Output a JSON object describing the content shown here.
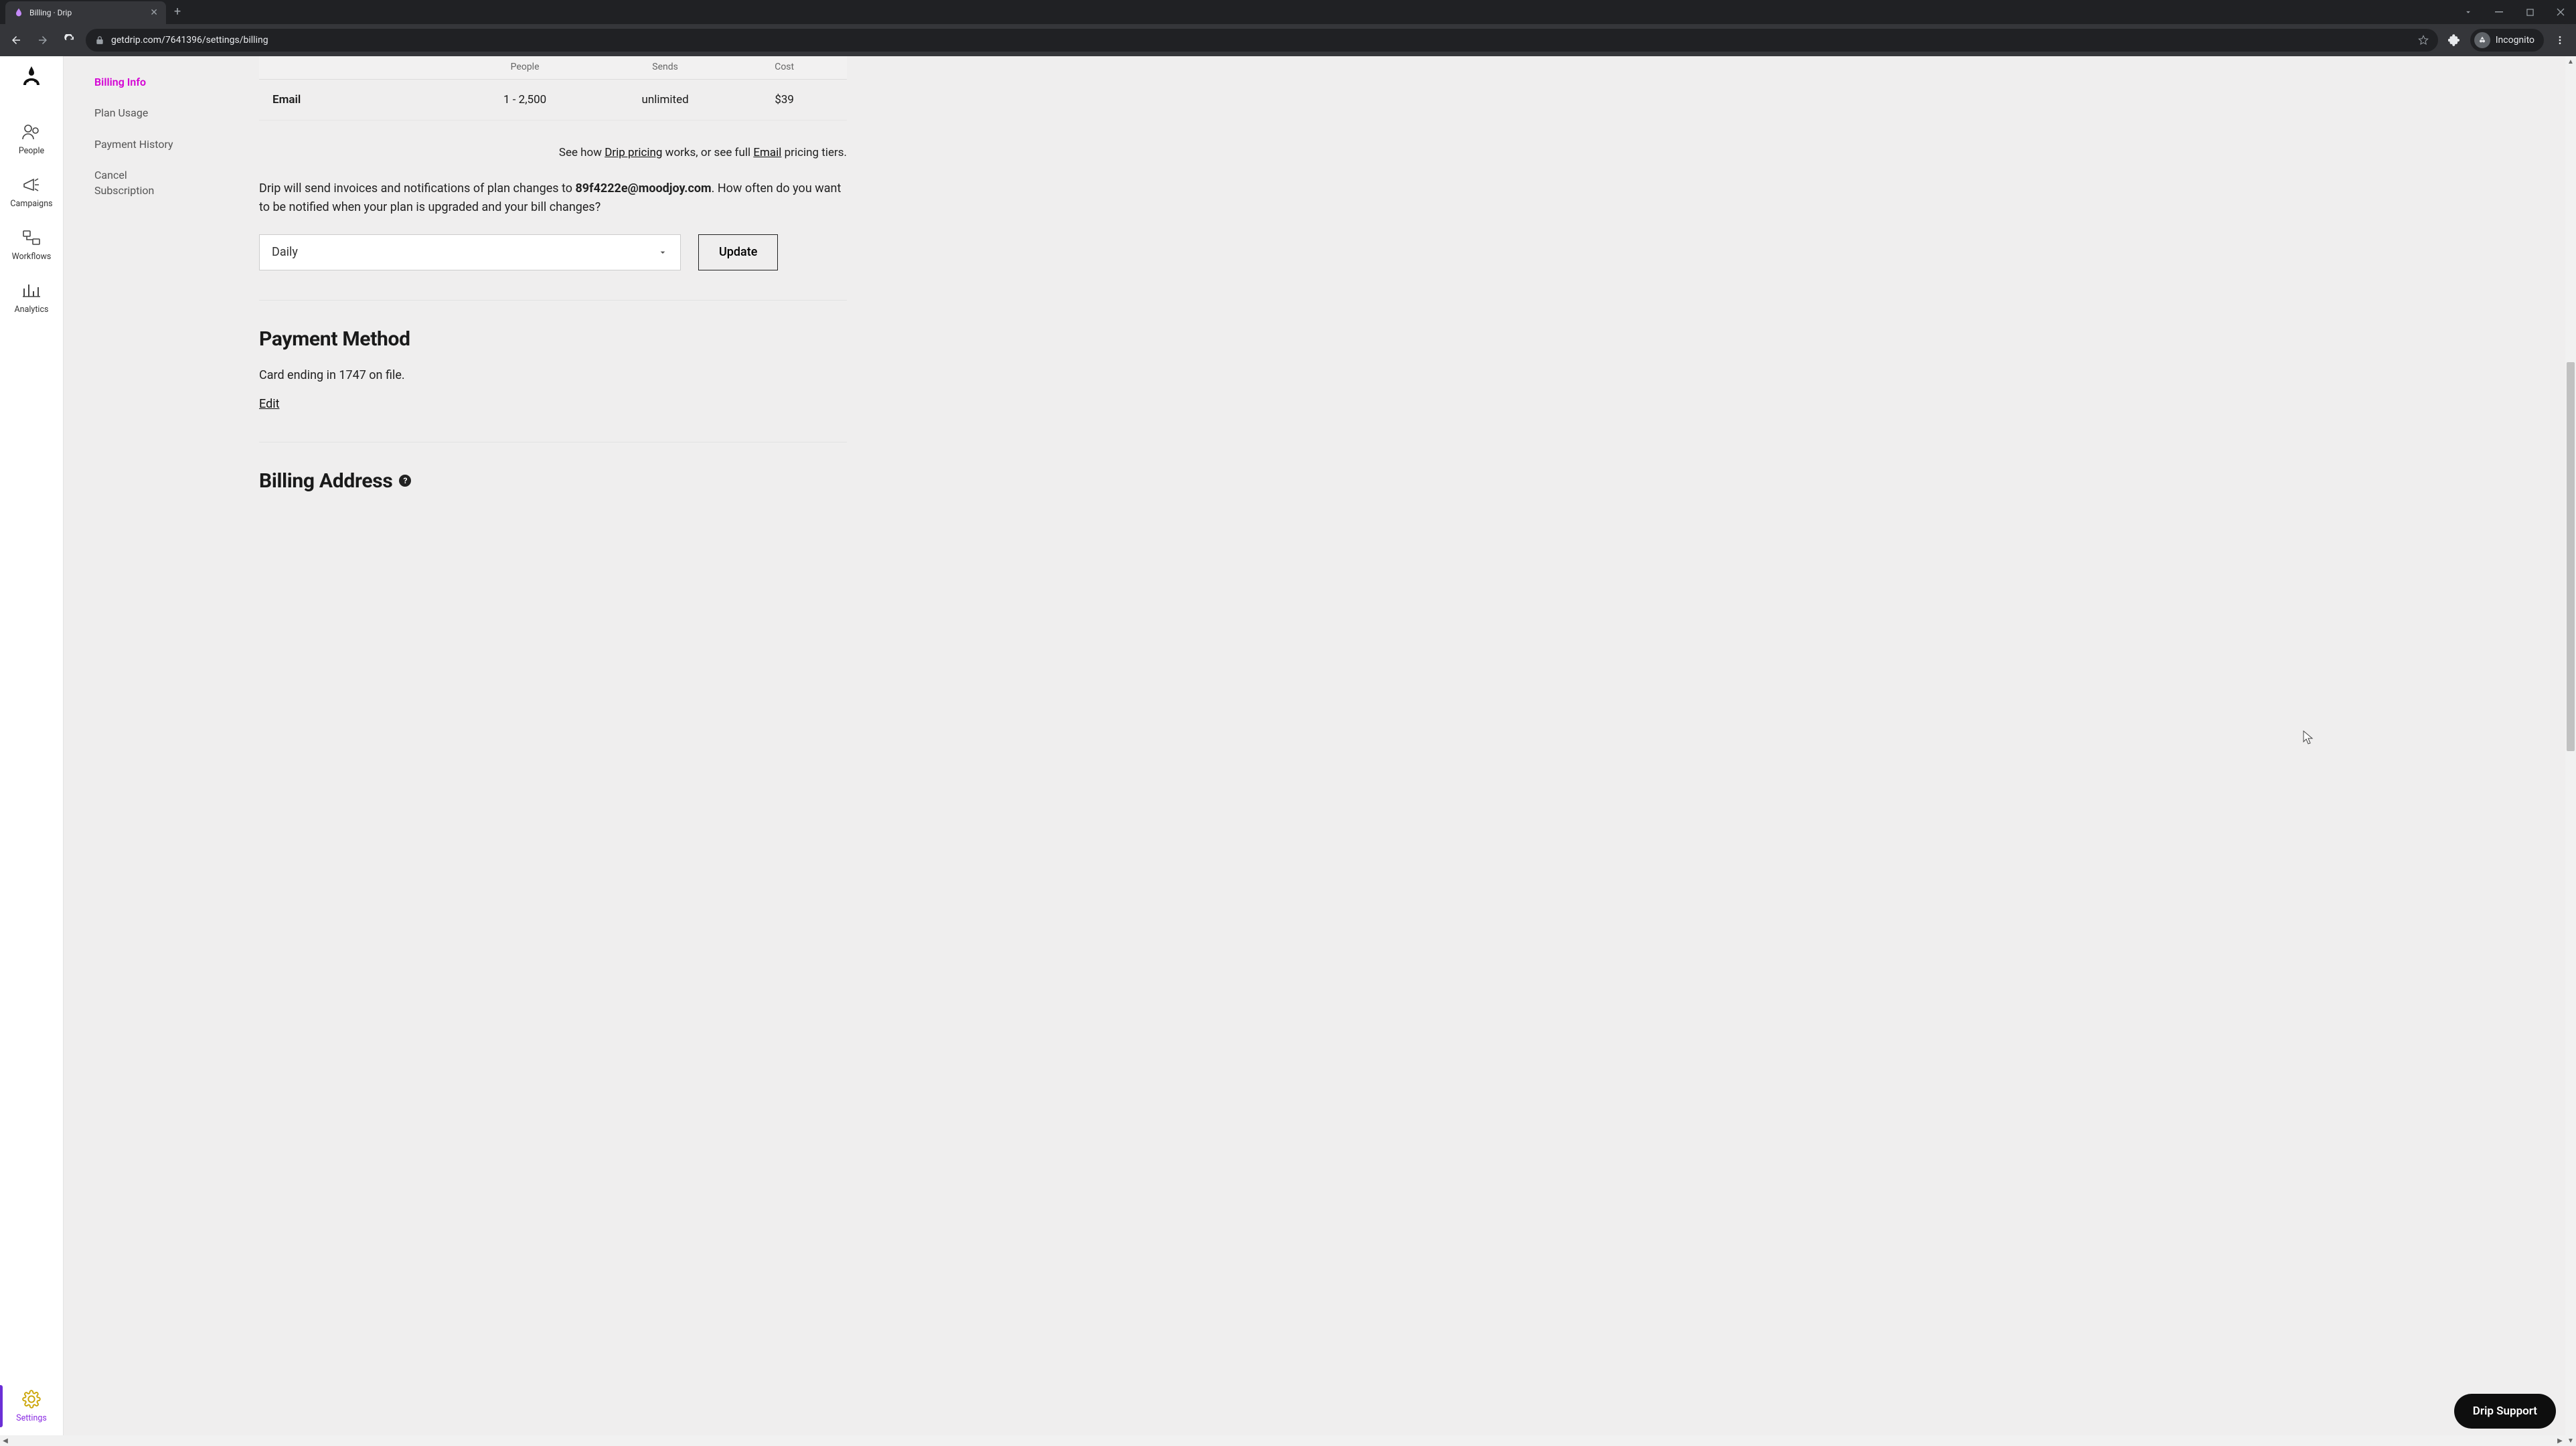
{
  "browser": {
    "tab_title": "Billing · Drip",
    "url": "getdrip.com/7641396/settings/billing",
    "incognito_label": "Incognito"
  },
  "sidebar": {
    "items": [
      {
        "label": "People"
      },
      {
        "label": "Campaigns"
      },
      {
        "label": "Workflows"
      },
      {
        "label": "Analytics"
      }
    ],
    "bottom": {
      "label": "Settings"
    }
  },
  "subnav": {
    "items": [
      {
        "label": "Billing Info",
        "active": true
      },
      {
        "label": "Plan Usage"
      },
      {
        "label": "Payment History"
      },
      {
        "label": "Cancel Subscription"
      }
    ]
  },
  "plan_table": {
    "headers": [
      "",
      "People",
      "Sends",
      "Cost"
    ],
    "row": {
      "plan": "Email",
      "people": "1 - 2,500",
      "sends": "unlimited",
      "cost": "$39"
    }
  },
  "pricing_note": {
    "pre": "See how ",
    "link1": "Drip pricing",
    "mid": " works, or see full ",
    "link2": "Email",
    "post": " pricing tiers."
  },
  "invoice": {
    "pre": "Drip will send invoices and notifications of plan changes to ",
    "email": "89f4222e@moodjoy.com",
    "post": ". How often do you want to be notified when your plan is upgraded and your bill changes?"
  },
  "frequency": {
    "value": "Daily",
    "update_label": "Update"
  },
  "payment_method": {
    "heading": "Payment Method",
    "card_text": "Card ending in 1747 on file.",
    "edit_label": "Edit"
  },
  "billing_address": {
    "heading": "Billing Address"
  },
  "support": {
    "label": "Drip Support"
  }
}
